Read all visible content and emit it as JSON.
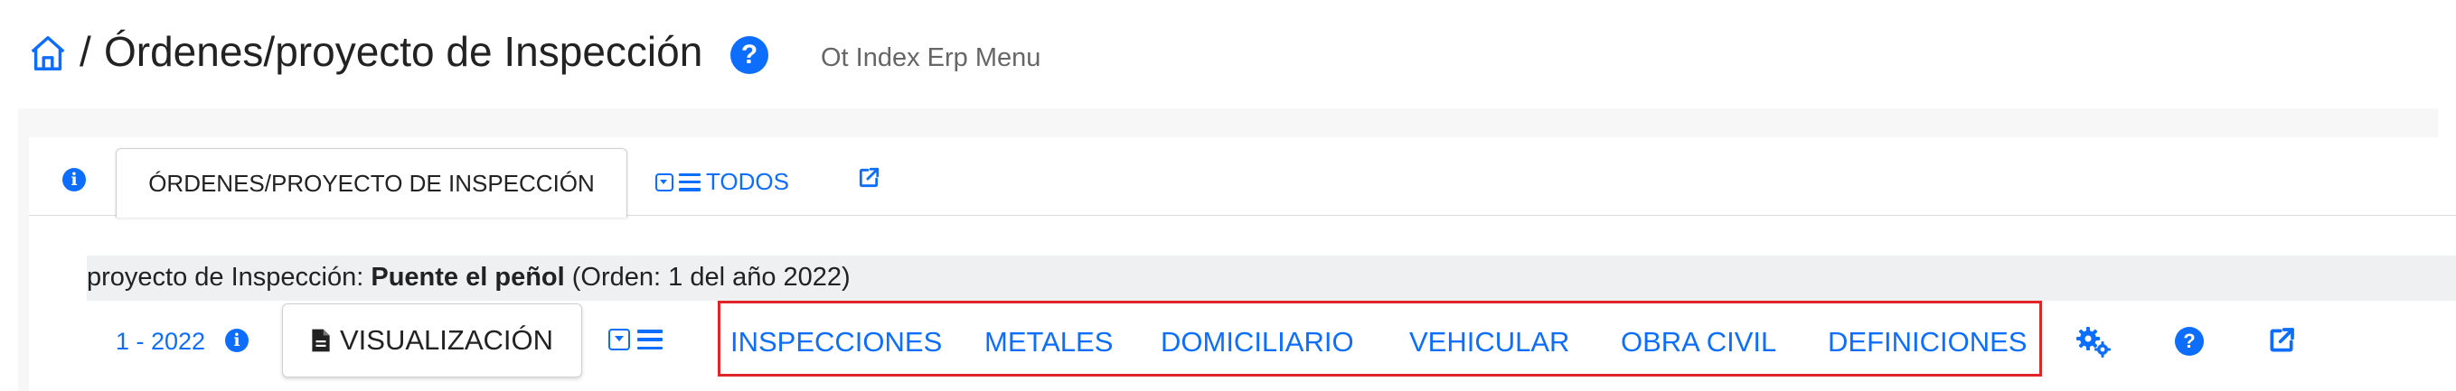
{
  "header": {
    "separator": "/",
    "title": "Órdenes/proyecto de Inspección",
    "help_glyph": "?",
    "subtitle": "Ot Index Erp Menu"
  },
  "tabs": {
    "info_glyph": "i",
    "active_tab_label": "ÓRDENES/PROYECTO DE INSPECCIÓN",
    "todos_label": "TODOS"
  },
  "project": {
    "prefix": "proyecto de Inspección:",
    "name": "Puente el peñol",
    "suffix": "(Orden: 1 del año 2022)"
  },
  "nav": {
    "order_id": "1 - 2022",
    "info_glyph": "i",
    "visualize_label": "VISUALIZACIÓN",
    "links": [
      {
        "label": "INSPECCIONES"
      },
      {
        "label": "METALES"
      },
      {
        "label": "DOMICILIARIO"
      },
      {
        "label": "VEHICULAR"
      },
      {
        "label": "OBRA CIVIL"
      },
      {
        "label": "DEFINICIONES"
      }
    ],
    "help_glyph": "?"
  },
  "icons": {
    "home": "home-icon",
    "help": "question-circle-icon",
    "info": "info-circle-icon",
    "dropdown": "caret-square-down-icon",
    "list": "bars-icon",
    "external": "external-link-icon",
    "settings": "cogs-icon",
    "document": "file-icon"
  },
  "colors": {
    "accent": "#0d6efd",
    "highlight_frame": "#e0262a",
    "project_bar": "#eef0f2"
  }
}
